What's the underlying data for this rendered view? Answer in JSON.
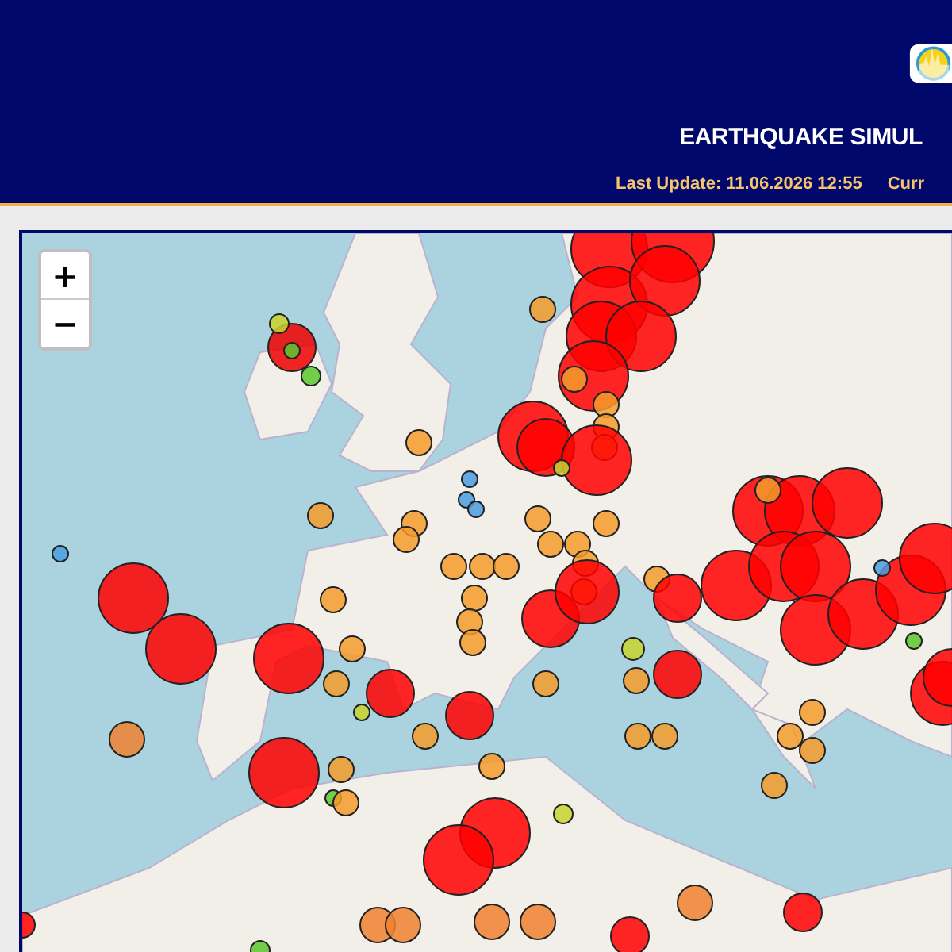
{
  "header": {
    "title": "EARTHQUAKE SIMUL",
    "last_update": "Last Update: 11.06.2026 12:55",
    "current": "Curr"
  },
  "map": {
    "zoom_controls": [
      {
        "label": "+"
      },
      {
        "label": "−"
      }
    ]
  }
}
